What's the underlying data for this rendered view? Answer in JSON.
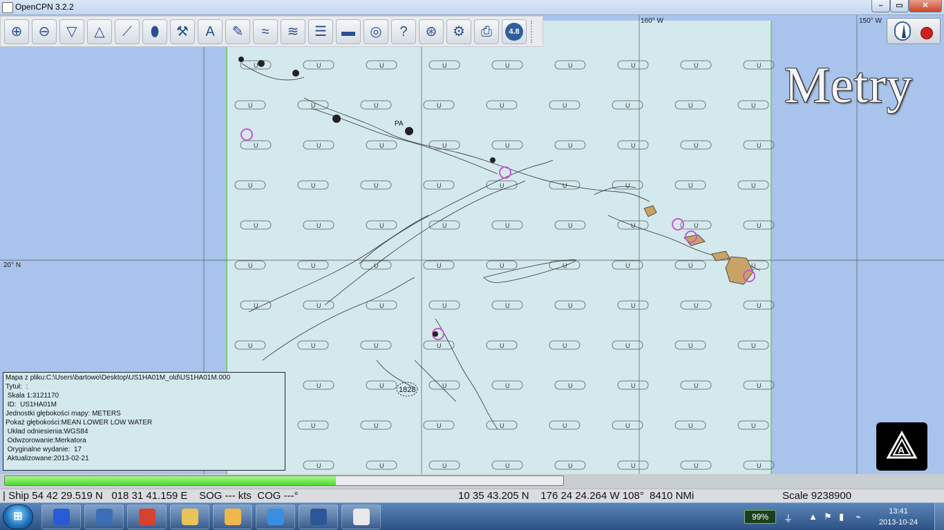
{
  "window": {
    "title": "OpenCPN 3.2.2",
    "minimize_glyph": "–",
    "maximize_glyph": "▭",
    "close_glyph": "✕"
  },
  "toolbar": {
    "buttons": [
      {
        "name": "zoom-in",
        "icon": "zoom-in-icon",
        "glyph": "⊕"
      },
      {
        "name": "zoom-out",
        "icon": "zoom-out-icon",
        "glyph": "⊖"
      },
      {
        "name": "scale-in",
        "icon": "scale-in-icon",
        "glyph": "▽"
      },
      {
        "name": "scale-out",
        "icon": "scale-out-icon",
        "glyph": "△"
      },
      {
        "name": "route",
        "icon": "route-icon",
        "glyph": "⟋"
      },
      {
        "name": "auto-follow",
        "icon": "ship-icon",
        "glyph": "⬮"
      },
      {
        "name": "settings",
        "icon": "wrench-icon",
        "glyph": "⚒"
      },
      {
        "name": "text",
        "icon": "text-icon",
        "glyph": "A"
      },
      {
        "name": "current",
        "icon": "current-icon",
        "glyph": "✎"
      },
      {
        "name": "tides",
        "icon": "tide-icon",
        "glyph": "≈"
      },
      {
        "name": "currents",
        "icon": "wave-icon",
        "glyph": "≋"
      },
      {
        "name": "route-manager",
        "icon": "route-manager-icon",
        "glyph": "☰"
      },
      {
        "name": "color-scheme",
        "icon": "color-scheme-icon",
        "glyph": "▬"
      },
      {
        "name": "mob",
        "icon": "lifebuoy-icon",
        "glyph": "◎"
      },
      {
        "name": "help",
        "icon": "help-icon",
        "glyph": "?"
      },
      {
        "name": "track",
        "icon": "track-icon",
        "glyph": "⊛"
      },
      {
        "name": "ais",
        "icon": "ais-icon",
        "glyph": "⚙"
      },
      {
        "name": "print",
        "icon": "print-icon",
        "glyph": "⎙"
      },
      {
        "name": "chart-scale",
        "icon": "scale-badge-icon",
        "glyph": "4.8"
      }
    ]
  },
  "map": {
    "label_160w": "160° W",
    "label_150w": "150° W",
    "label_20n": "20° N",
    "units_banner": "Metry",
    "place_label_pa": "PA",
    "place_label_1828": "1828",
    "sounding_u": "U"
  },
  "info_box": {
    "lines": [
      "Mapa z pliku:C:\\Users\\bartowo\\Desktop\\US1HA01M_old\\US1HA01M.000",
      "Tytuł:  :",
      " Skala 1:3121170",
      " ID:  US1HA01M",
      "Jednostki głębokości mapy: METERS",
      "Pokaż głębokości:MEAN LOWER LOW WATER",
      " Układ odniesienia:WGS84",
      " Odwzorowanie:Merkatora",
      " Oryginalne wydanie:  17",
      " Aktualizowane:2013-02-21"
    ]
  },
  "progress": {
    "value": 0.593
  },
  "status": {
    "ship": "| Ship 54 42 29.519 N   018 31 41.159 E    SOG --- kts  COG ---°",
    "cursor": "10 35 43.205 N    176 24 24.264 W 108°  8410 NMi",
    "scale": "Scale 9238900"
  },
  "taskbar": {
    "start_glyph": "⊞",
    "apps": [
      {
        "name": "app-media",
        "color": "#2a5bd7"
      },
      {
        "name": "app-thunderbird",
        "color": "#3b6fb5"
      },
      {
        "name": "app-chrome",
        "color": "#d9412f"
      },
      {
        "name": "app-explorer",
        "color": "#e8c35a"
      },
      {
        "name": "app-outlook",
        "color": "#f0b84a"
      },
      {
        "name": "app-ie",
        "color": "#3a8ee0"
      },
      {
        "name": "app-word",
        "color": "#2b5797"
      },
      {
        "name": "app-opencpn",
        "color": "#e9e9e9"
      }
    ],
    "battery": "99%",
    "time": "13:41",
    "date": "2013-10-24"
  }
}
